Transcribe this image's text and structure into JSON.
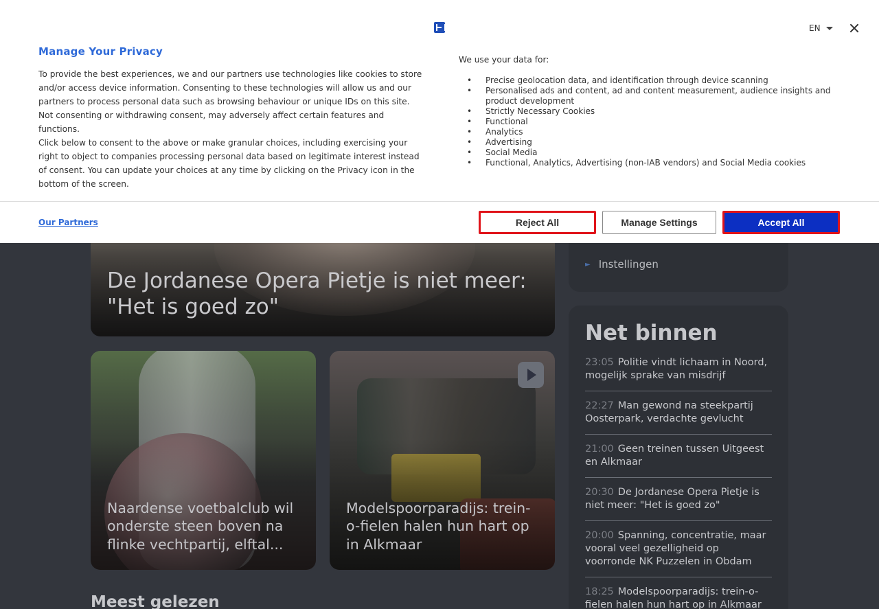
{
  "consent": {
    "title": "Manage Your Privacy",
    "paragraph_1": "To provide the best experiences, we and our partners use technologies like cookies to store and/or access device information. Consenting to these technologies will allow us and our partners to process personal data such as browsing behaviour or unique IDs on this site. Not consenting or withdrawing consent, may adversely affect certain features and functions.",
    "paragraph_2": "Click below to consent to the above or make granular choices, including exercising your right to object to companies processing personal data based on legitimate interest instead of consent. You can update your choices at any time by clicking on the Privacy icon in the bottom of the screen.",
    "uses_heading": "We use your data for:",
    "uses": [
      "Precise geolocation data, and identification through device scanning",
      "Personalised ads and content, ad and content measurement, audience insights and product development",
      "Strictly Necessary Cookies",
      "Functional",
      "Analytics",
      "Advertising",
      "Social Media",
      "Functional, Analytics, Advertising (non-IAB vendors) and Social Media cookies"
    ],
    "language": "EN",
    "partners_link": "Our Partners",
    "reject_label": "Reject All",
    "manage_label": "Manage Settings",
    "accept_label": "Accept All",
    "accent_color": "#2f6ad8",
    "accept_color": "#0c2fc2"
  },
  "page": {
    "hero_title": "De Jordanese Opera Pietje is niet meer: \"Het is goed zo\"",
    "card_left_title": "Naardense voetbalclub wil onderste steen boven na flinke vechtpartij, elftal...",
    "card_right_title": "Modelspoorparadijs: trein-o-fielen halen hun hart op in Alkmaar",
    "section_heading": "Meest gelezen",
    "side_menu_item": "Instellingen",
    "net_binnen_title": "Net binnen",
    "net_binnen": [
      {
        "time": "23:05",
        "text": "Politie vindt lichaam in Noord, mogelijk sprake van misdrijf"
      },
      {
        "time": "22:27",
        "text": "Man gewond na steekpartij Oosterpark, verdachte gevlucht"
      },
      {
        "time": "21:00",
        "text": "Geen treinen tussen Uitgeest en Alkmaar"
      },
      {
        "time": "20:30",
        "text": "De Jordanese Opera Pietje is niet meer: \"Het is goed zo\""
      },
      {
        "time": "20:00",
        "text": "Spanning, concentratie, maar vooral veel gezelligheid op voorronde NK Puzzelen in Obdam"
      },
      {
        "time": "18:25",
        "text": "Modelspoorparadijs: trein-o-fielen halen hun hart op in Alkmaar"
      }
    ]
  }
}
